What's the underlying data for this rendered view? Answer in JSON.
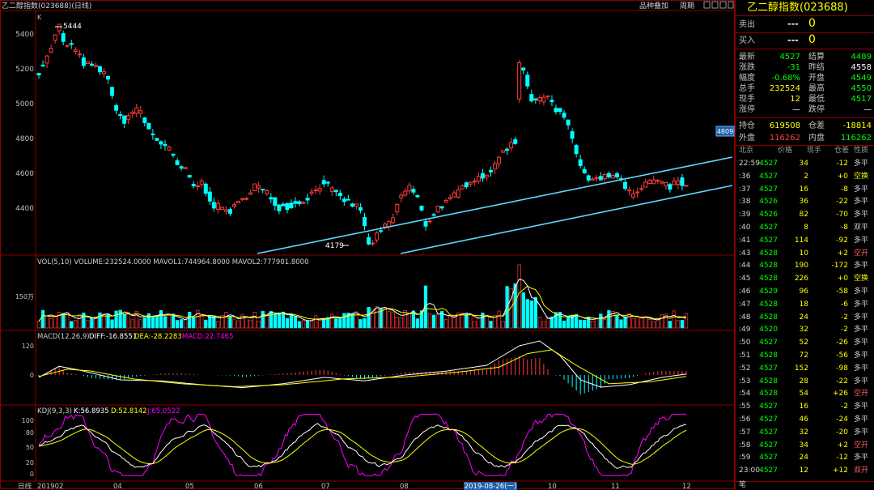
{
  "window": {
    "title": "乙二醇指数(023688)(日线)",
    "buttons": [
      "品种叠加",
      "周期"
    ],
    "win_controls": [
      "▢",
      "▢",
      "▢",
      "▢"
    ]
  },
  "main_panel": {
    "corner_label": "K",
    "y_ticks": [
      "5400",
      "5200",
      "5000",
      "4800",
      "4600",
      "4400"
    ],
    "high_label": "5444",
    "low_label": "4179",
    "price_tag": "4809"
  },
  "volume_panel": {
    "header": "VOL(5,10) VOLUME:232524.0000 MAVOL1:744964.8000 MAVOL2:777901.8000",
    "y_tick": "150万"
  },
  "macd_panel": {
    "name": "MACD(12,26,9)",
    "diff": "DIFF:-16.8551",
    "dea": "DEA:-28.2283",
    "macd": "MACD:22.7465",
    "y_ticks": [
      "120",
      "0"
    ]
  },
  "kdj_panel": {
    "name": "KDJ(9,3,3)",
    "k": "K:56.8935",
    "d": "D:52.8142",
    "j": "J:65.0522",
    "y_ticks": [
      "100",
      "80",
      "50",
      "20",
      "0"
    ]
  },
  "x_axis": {
    "corner": "日线",
    "labels": [
      "201902",
      "04",
      "05",
      "06",
      "07",
      "08",
      "10",
      "11",
      "12"
    ],
    "cursor_date": "2019-08-26(一)"
  },
  "quote": {
    "title": "乙二醇指数(023688)",
    "sell_label": "卖出",
    "sell_price": "---",
    "sell_qty": "0",
    "buy_label": "买入",
    "buy_price": "---",
    "buy_qty": "0",
    "stats": [
      [
        "最新",
        "4527",
        "结算",
        "4489"
      ],
      [
        "涨跌",
        "-31",
        "昨结",
        "4558"
      ],
      [
        "幅度",
        "-0.68%",
        "开盘",
        "4549"
      ],
      [
        "总手",
        "232524",
        "最高",
        "4550"
      ],
      [
        "现手",
        "12",
        "最低",
        "4517"
      ],
      [
        "涨停",
        "—",
        "跌停",
        "—"
      ],
      [
        "持仓",
        "619508",
        "仓差",
        "-18814"
      ],
      [
        "外盘",
        "116262",
        "内盘",
        "116262"
      ]
    ],
    "tick_header": [
      "北京",
      "价格",
      "现手",
      "仓差",
      "性质"
    ],
    "ticks": [
      [
        "22:59",
        "4527",
        "34",
        "-12",
        "多平"
      ],
      [
        ":36",
        "4527",
        "2",
        "+0",
        "空换"
      ],
      [
        ":37",
        "4527",
        "16",
        "-8",
        "多平"
      ],
      [
        ":38",
        "4526",
        "36",
        "-22",
        "多平"
      ],
      [
        ":39",
        "4526",
        "82",
        "-70",
        "多平"
      ],
      [
        ":40",
        "4527",
        "8",
        "-8",
        "双平"
      ],
      [
        ":41",
        "4527",
        "114",
        "-92",
        "多平"
      ],
      [
        ":43",
        "4528",
        "10",
        "+2",
        "空开"
      ],
      [
        ":44",
        "4528",
        "190",
        "-172",
        "多平"
      ],
      [
        ":45",
        "4528",
        "226",
        "+0",
        "空换"
      ],
      [
        ":46",
        "4529",
        "96",
        "-58",
        "多平"
      ],
      [
        ":47",
        "4528",
        "18",
        "-6",
        "多平"
      ],
      [
        ":48",
        "4528",
        "24",
        "-2",
        "多平"
      ],
      [
        ":49",
        "4520",
        "32",
        "-2",
        "多平"
      ],
      [
        ":50",
        "4527",
        "52",
        "-26",
        "多平"
      ],
      [
        ":51",
        "4528",
        "72",
        "-56",
        "多平"
      ],
      [
        ":52",
        "4527",
        "152",
        "-98",
        "多平"
      ],
      [
        ":53",
        "4528",
        "28",
        "-22",
        "多平"
      ],
      [
        ":54",
        "4528",
        "54",
        "+26",
        "空开"
      ],
      [
        ":55",
        "4527",
        "16",
        "-2",
        "多平"
      ],
      [
        ":56",
        "4527",
        "46",
        "-24",
        "多平"
      ],
      [
        ":57",
        "4527",
        "32",
        "-20",
        "多平"
      ],
      [
        ":58",
        "4527",
        "34",
        "+2",
        "空开"
      ],
      [
        ":59",
        "4527",
        "24",
        "-12",
        "多平"
      ],
      [
        "23:00",
        "4527",
        "12",
        "+12",
        "双开"
      ]
    ],
    "footer": "笔"
  },
  "colors": {
    "up": "#ff3b3b",
    "down": "#00ffff",
    "panel_border": "#8b0000",
    "trendline": "#5fd7ff",
    "ma1": "#ffffff",
    "ma2": "#ffff00",
    "ma3": "#ff00ff"
  }
}
